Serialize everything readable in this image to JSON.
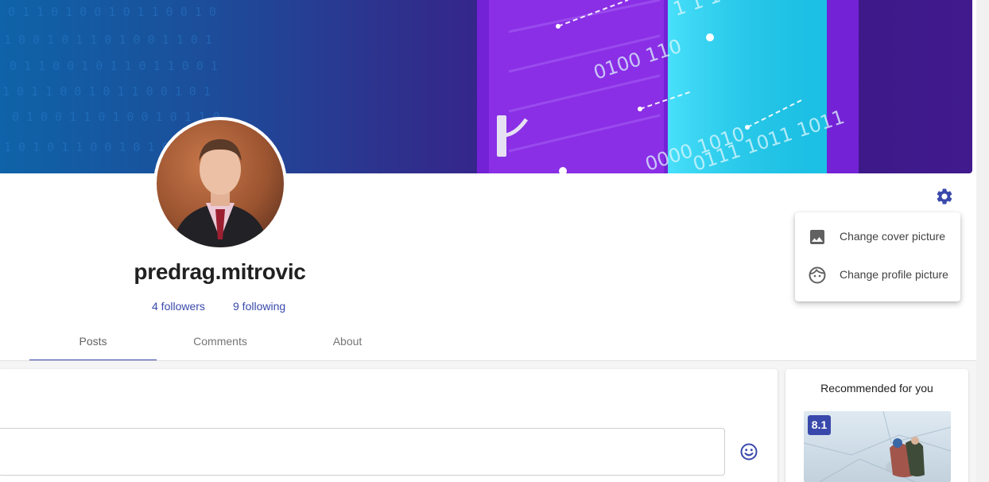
{
  "profile": {
    "username": "predrag.mitrovic",
    "followers_label": "4 followers",
    "following_label": "9 following"
  },
  "tabs": [
    {
      "label": "Posts",
      "active": true
    },
    {
      "label": "Comments",
      "active": false
    },
    {
      "label": "About",
      "active": false
    }
  ],
  "settings_menu": {
    "items": [
      {
        "label": "Change cover picture",
        "icon": "image-icon"
      },
      {
        "label": "Change profile picture",
        "icon": "face-icon"
      }
    ]
  },
  "recommended": {
    "title": "Recommended for you",
    "rating": "8.1"
  },
  "colors": {
    "accent": "#3949ab",
    "text": "#212121",
    "muted": "#757575"
  }
}
